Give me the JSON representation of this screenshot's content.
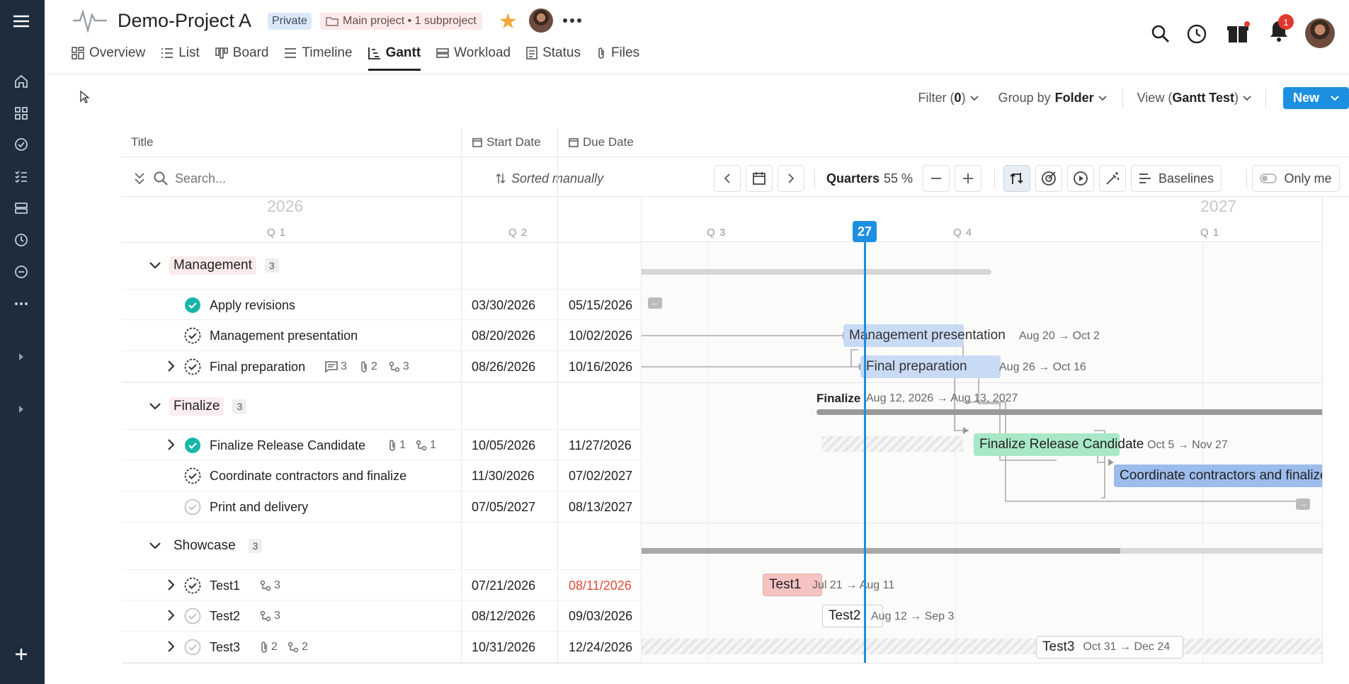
{
  "project": {
    "title": "Demo-Project A",
    "privacy": "Private",
    "hierarchy": "Main project • 1 subproject"
  },
  "nav": {
    "overview": "Overview",
    "list": "List",
    "board": "Board",
    "timeline": "Timeline",
    "gantt": "Gantt",
    "workload": "Workload",
    "status": "Status",
    "files": "Files"
  },
  "notifications": {
    "count": "1"
  },
  "toolbar": {
    "filter_label": "Filter (",
    "filter_count": "0",
    "filter_close": ")",
    "group_label": "Group by",
    "group_value": "Folder",
    "view_label": "View (",
    "view_value": "Gantt Test",
    "view_close": ")",
    "new_label": "New"
  },
  "columns": {
    "title": "Title",
    "start": "Start Date",
    "due": "Due Date"
  },
  "search": {
    "placeholder": "Search...",
    "sort": "Sorted manually",
    "zoom_label": "Quarters",
    "zoom_value": "55 %",
    "baselines": "Baselines",
    "only_me": "Only me"
  },
  "timescale": {
    "year_left": "2026",
    "year_right": "2027",
    "q_left1": "Q 1",
    "q_left2": "Q 2",
    "q3": "Q 3",
    "q4": "Q 4",
    "q1_next": "Q 1",
    "today": "27"
  },
  "groups": [
    {
      "name": "Management",
      "count": "3",
      "tasks": [
        {
          "title": "Apply revisions",
          "start": "03/30/2026",
          "due": "05/15/2026"
        },
        {
          "title": "Management presentation",
          "start": "08/20/2026",
          "due": "10/02/2026"
        },
        {
          "title": "Final preparation",
          "start": "08/26/2026",
          "due": "10/16/2026",
          "comments": "3",
          "attachments": "2",
          "subtasks": "3"
        }
      ]
    },
    {
      "name": "Finalize",
      "count": "3",
      "tasks": [
        {
          "title": "Finalize Release Candidate",
          "start": "10/05/2026",
          "due": "11/27/2026",
          "attachments": "1",
          "subtasks": "1"
        },
        {
          "title": "Coordinate contractors and finalize",
          "start": "11/30/2026",
          "due": "07/02/2027"
        },
        {
          "title": "Print and delivery",
          "start": "07/05/2027",
          "due": "08/13/2027"
        }
      ]
    },
    {
      "name": "Showcase",
      "count": "3",
      "tasks": [
        {
          "title": "Test1",
          "start": "07/21/2026",
          "due": "08/11/2026",
          "subtasks": "3"
        },
        {
          "title": "Test2",
          "start": "08/12/2026",
          "due": "09/03/2026",
          "subtasks": "3"
        },
        {
          "title": "Test3",
          "start": "10/31/2026",
          "due": "12/24/2026",
          "attachments": "2",
          "subtasks": "2"
        }
      ]
    }
  ],
  "bars": {
    "mgmt_pres": {
      "label": "Management presentation",
      "range": "Aug 20 → Oct 2"
    },
    "final_prep": {
      "label": "Final preparation",
      "range": "Aug 26 → Oct 16"
    },
    "finalize_group": {
      "label": "Finalize",
      "range": "Aug 12, 2026 → Aug 13, 2027"
    },
    "frc": {
      "label": "Finalize Release Candidate",
      "range": "Oct 5 → Nov 27"
    },
    "coord": {
      "label": "Coordinate contractors and finalize"
    },
    "test1": {
      "label": "Test1",
      "range": "Jul 21 → Aug 11"
    },
    "test2": {
      "label": "Test2",
      "range": "Aug 12 → Sep 3"
    },
    "test3": {
      "label": "Test3",
      "range": "Oct 31 → Dec 24"
    }
  },
  "colors": {
    "sidebar": "#1e2d3d",
    "accent": "#1d8fe1",
    "done": "#19b5a8",
    "overdue": "#e04a3a",
    "bar_blue": "#c9daf5",
    "bar_green": "#a8e8c7",
    "bar_red": "#f6c3c3"
  }
}
